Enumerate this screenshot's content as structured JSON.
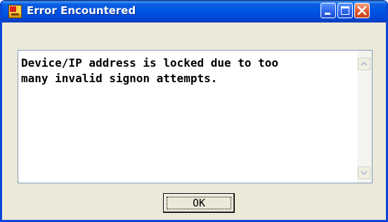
{
  "window": {
    "title": "Error Encountered",
    "icon": "app-icon"
  },
  "controls": {
    "minimize_icon": "minimize-icon",
    "maximize_icon": "maximize-icon",
    "close_icon": "close-icon"
  },
  "message": {
    "text": "Device/IP address is locked due to too\nmany invalid signon attempts."
  },
  "buttons": {
    "ok_label": "OK"
  },
  "colors": {
    "titlebar": "#0055e5",
    "dialog_background": "#ece9d8",
    "close_button": "#e0562a"
  }
}
